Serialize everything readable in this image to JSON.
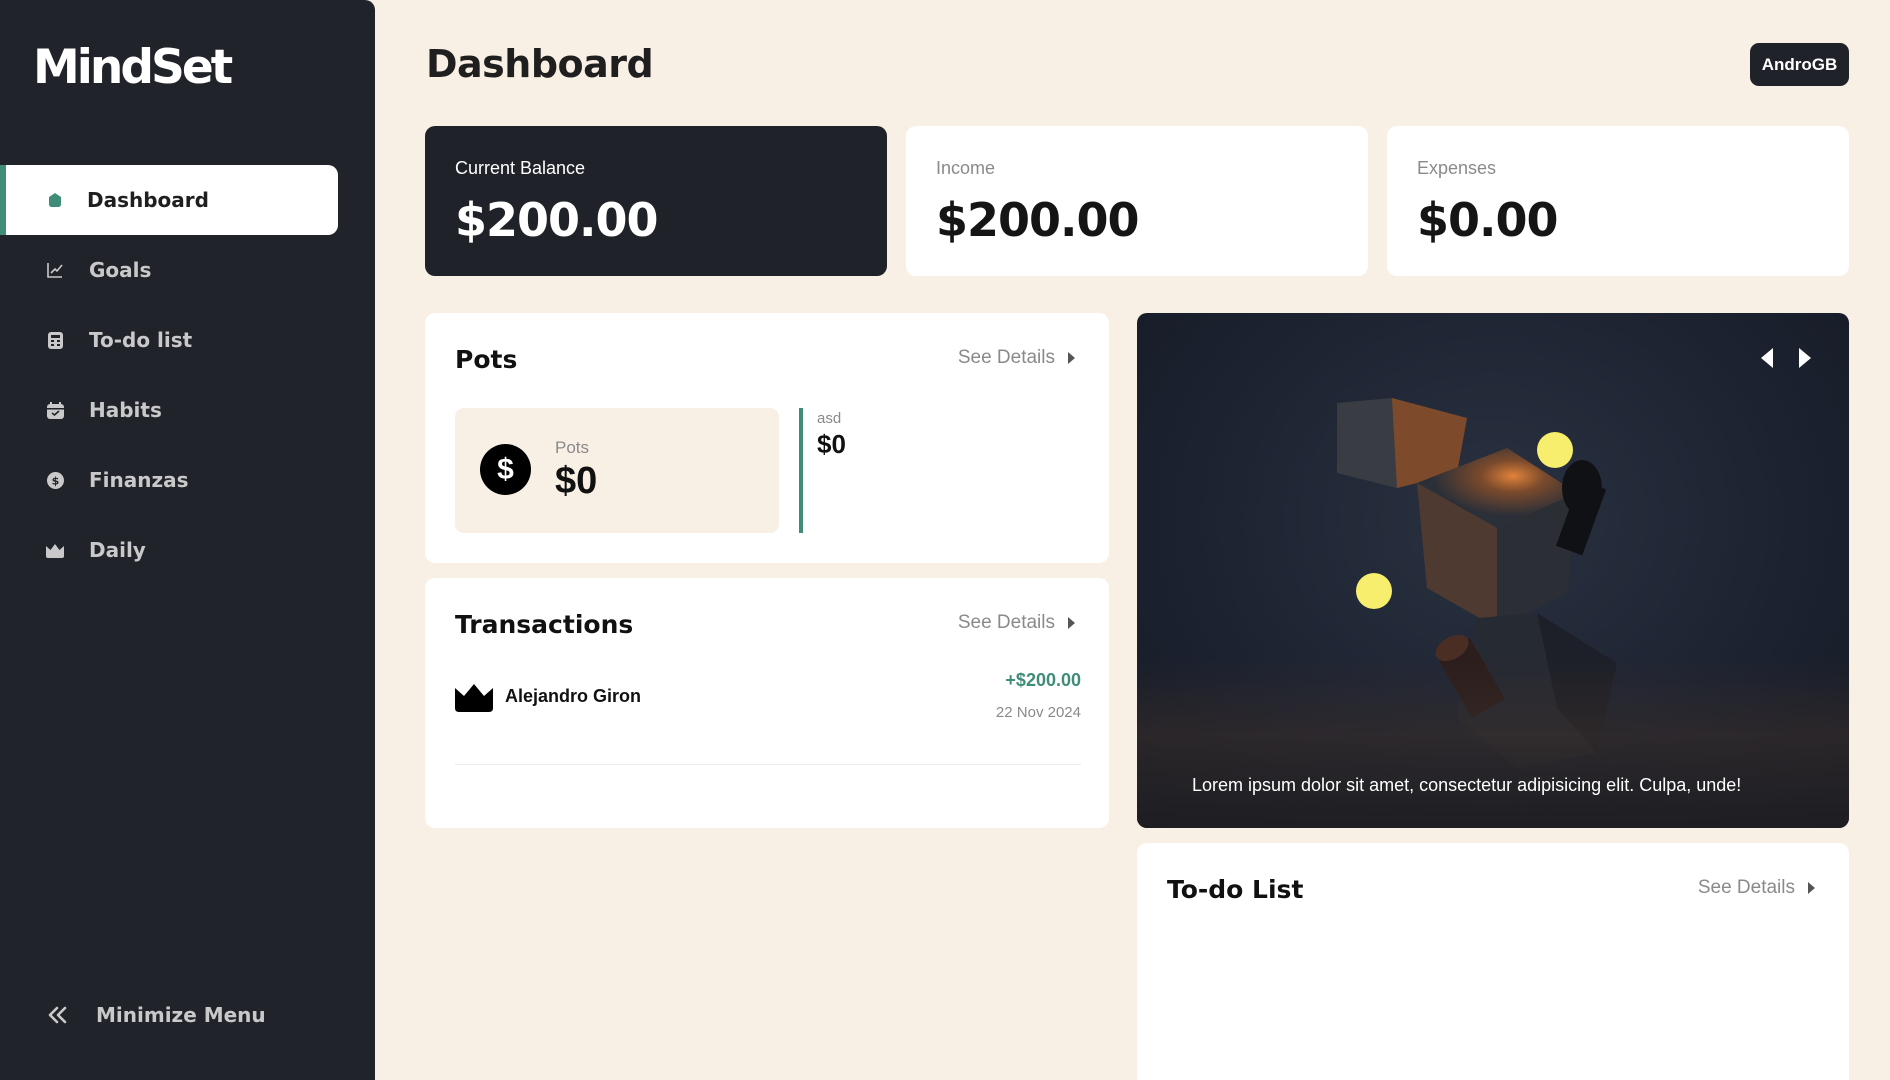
{
  "app": {
    "name": "MindSet"
  },
  "sidebar": {
    "items": [
      {
        "label": "Dashboard",
        "icon": "circle-icon",
        "active": true
      },
      {
        "label": "Goals",
        "icon": "chart-line-icon"
      },
      {
        "label": "To-do list",
        "icon": "calculator-icon"
      },
      {
        "label": "Habits",
        "icon": "calendar-icon"
      },
      {
        "label": "Finanzas",
        "icon": "dollar-circle-icon"
      },
      {
        "label": "Daily",
        "icon": "crown-icon"
      }
    ],
    "minimize_label": "Minimize Menu"
  },
  "header": {
    "title": "Dashboard",
    "user": "AndroGB"
  },
  "stats": {
    "balance": {
      "label": "Current Balance",
      "value": "$200.00"
    },
    "income": {
      "label": "Income",
      "value": "$200.00"
    },
    "expenses": {
      "label": "Expenses",
      "value": "$0.00"
    }
  },
  "pots": {
    "title": "Pots",
    "see_details": "See Details",
    "total": {
      "label": "Pots",
      "value": "$0"
    },
    "items": [
      {
        "label": "asd",
        "value": "$0"
      }
    ]
  },
  "transactions": {
    "title": "Transactions",
    "see_details": "See Details",
    "items": [
      {
        "name": "Alejandro Giron",
        "amount": "+$200.00",
        "date": "22 Nov 2024"
      }
    ]
  },
  "hero": {
    "caption": "Lorem ipsum dolor sit amet, consectetur adipisicing elit. Culpa, unde!"
  },
  "todo": {
    "title": "To-do List",
    "see_details": "See Details"
  },
  "colors": {
    "accent": "#3f8c79",
    "sidebar_bg": "#202329",
    "page_bg": "#f8efe5"
  }
}
